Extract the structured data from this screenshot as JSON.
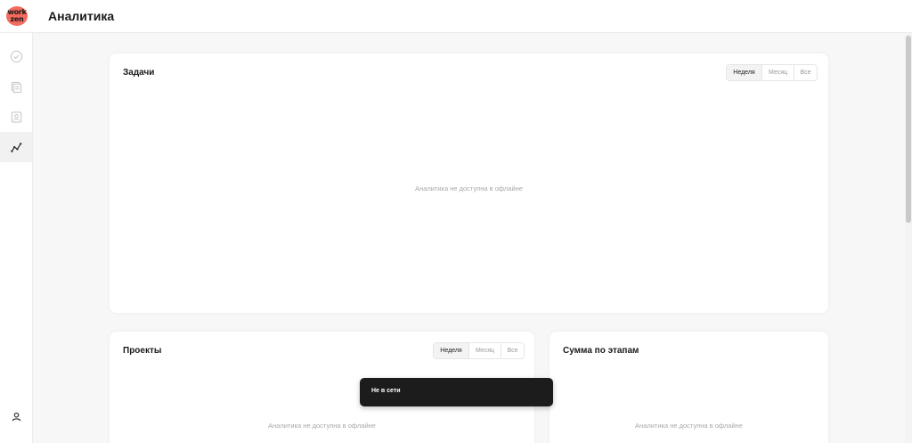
{
  "app": {
    "logo_text_top": "work",
    "logo_text_bottom": "zen",
    "page_title": "Аналитика",
    "brand_color": "#f26b5e"
  },
  "sidebar": {
    "items": [
      {
        "icon": "check-circle-icon",
        "active": false
      },
      {
        "icon": "documents-icon",
        "active": false
      },
      {
        "icon": "contact-card-icon",
        "active": false
      },
      {
        "icon": "analytics-icon",
        "active": true
      }
    ],
    "bottom_icon": "user-icon"
  },
  "cards": {
    "tasks": {
      "title": "Задачи",
      "periods": [
        "Неделя",
        "Месяц",
        "Все"
      ],
      "selected_period": "Неделя",
      "empty_message": "Аналитика не доступна в офлайне"
    },
    "projects": {
      "title": "Проекты",
      "periods": [
        "Неделя",
        "Месяц",
        "Все"
      ],
      "selected_period": "Неделя",
      "empty_message": "Аналитика не доступна в офлайне"
    },
    "stage_sum": {
      "title": "Сумма по этапам",
      "empty_message": "Аналитика не доступна в офлайне"
    }
  },
  "toast": {
    "text": "Не в сети"
  }
}
